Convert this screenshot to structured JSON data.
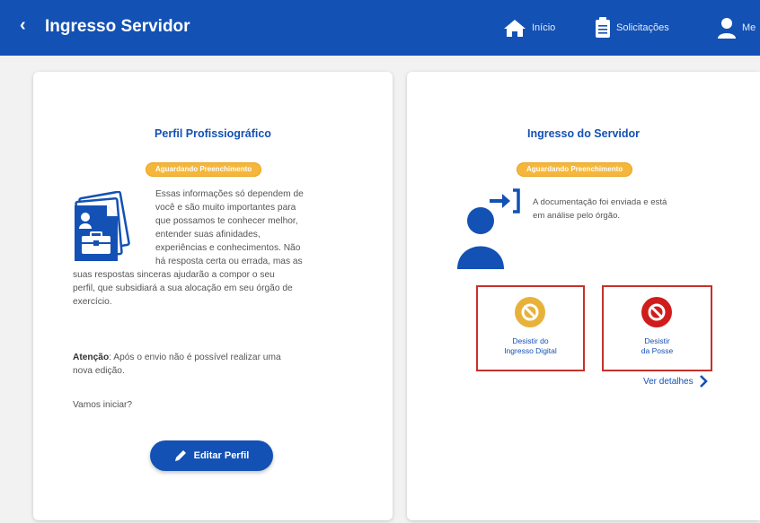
{
  "header": {
    "back_icon": "‹",
    "title": "Ingresso Servidor",
    "nav": {
      "home_label": "Início",
      "requests_label": "Solicitações",
      "profile_label": "Me"
    }
  },
  "left_card": {
    "title": "Perfil Profissiográfico",
    "badge": "Aguardando Preenchimento",
    "intro_lines": [
      "Essas informações só dependem de",
      "você e são muito importantes para",
      "que possamos te conhecer melhor,",
      "entender suas afinidades,",
      "experiências e conhecimentos. Não",
      "há resposta certa ou errada, mas as"
    ],
    "full_lines": [
      "suas respostas sinceras ajudarão a compor o seu",
      "perfil, que subsidiará a sua alocação em seu órgão de",
      "exercício."
    ],
    "attention_label": "Atenção",
    "attention_text": ": Após o envio não é possível realizar uma",
    "attention_text2": "nova edição.",
    "start_question": "Vamos iniciar?",
    "edit_button": "Editar Perfil"
  },
  "right_card": {
    "title": "Ingresso do Servidor",
    "badge": "Aguardando Preenchimento",
    "message_line1": "A documentação foi enviada e está",
    "message_line2": "em análise pelo órgão.",
    "status_digital_line1": "Desistir do",
    "status_digital_line2": "Ingresso Digital",
    "status_posse_line1": "Desistir",
    "status_posse_line2": "da Posse",
    "details_link": "Ver detalhes"
  },
  "colors": {
    "primary": "#1351b4",
    "badge": "#f5b73b",
    "status_yellow": "#e8b23a",
    "status_red": "#d01c1c",
    "box_border": "#c4322a"
  }
}
